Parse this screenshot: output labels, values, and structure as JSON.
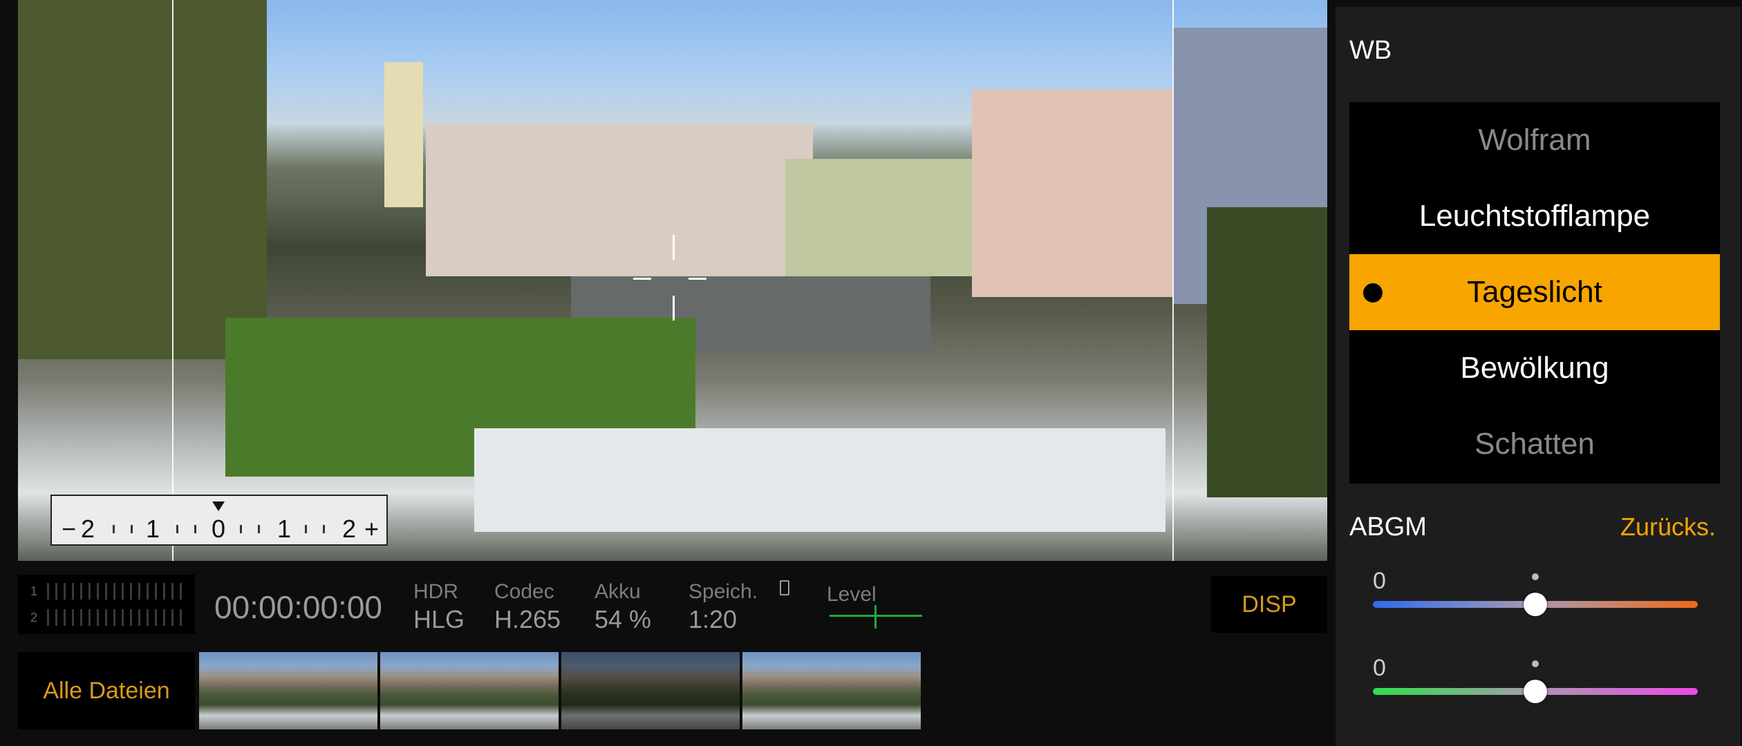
{
  "viewfinder": {
    "exposure_scale": [
      "−",
      "2",
      "1",
      "0",
      "1",
      "2",
      "+"
    ]
  },
  "status": {
    "audio_channels": [
      "1",
      "2"
    ],
    "timecode": "00:00:00:00",
    "hdr": {
      "label": "HDR",
      "value": "HLG"
    },
    "codec": {
      "label": "Codec",
      "value": "H.265"
    },
    "battery": {
      "label": "Akku",
      "value": "54 %"
    },
    "storage": {
      "label": "Speich.",
      "value": "1:20"
    },
    "level": {
      "label": "Level"
    },
    "disp_label": "DISP",
    "all_files_label": "Alle Dateien"
  },
  "wb": {
    "title": "WB",
    "options": [
      "Wolfram",
      "Leuchtstofflampe",
      "Tageslicht",
      "Bewölkung",
      "Schatten"
    ],
    "selected": "Tageslicht",
    "abgm_label": "ABGM",
    "reset_label": "Zurücks.",
    "sliders": [
      {
        "id": "amber-blue",
        "value": "0",
        "position": 0.5,
        "colors": [
          "#2f6cf0",
          "#f06a1a"
        ]
      },
      {
        "id": "green-magenta",
        "value": "0",
        "position": 0.5,
        "colors": [
          "#2ee04a",
          "#ee4ae8"
        ]
      }
    ]
  },
  "colors": {
    "accent": "#f8a500",
    "panel": "#1d1d1d",
    "background": "#0d0d0d"
  }
}
